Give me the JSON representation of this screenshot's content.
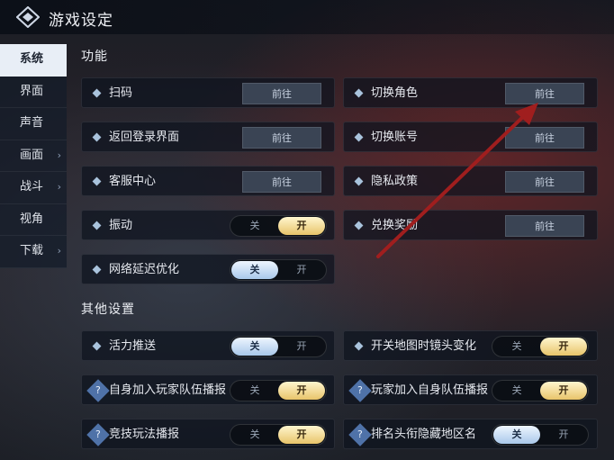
{
  "header": {
    "title": "游戏设定",
    "logo_icon": "diamond-emblem-icon"
  },
  "sidebar": {
    "items": [
      {
        "label": "系统",
        "active": true,
        "has_submenu": false
      },
      {
        "label": "界面",
        "active": false,
        "has_submenu": false
      },
      {
        "label": "声音",
        "active": false,
        "has_submenu": false
      },
      {
        "label": "画面",
        "active": false,
        "has_submenu": true
      },
      {
        "label": "战斗",
        "active": false,
        "has_submenu": true
      },
      {
        "label": "视角",
        "active": false,
        "has_submenu": false
      },
      {
        "label": "下载",
        "active": false,
        "has_submenu": true
      }
    ]
  },
  "sections": {
    "function_title": "功能",
    "other_title": "其他设置"
  },
  "function": {
    "scan": {
      "label": "扫码",
      "button": "前往"
    },
    "switch_role": {
      "label": "切换角色",
      "button": "前往"
    },
    "back_login": {
      "label": "返回登录界面",
      "button": "前往"
    },
    "switch_account": {
      "label": "切换账号",
      "button": "前往"
    },
    "customer_service": {
      "label": "客服中心",
      "button": "前往"
    },
    "privacy": {
      "label": "隐私政策",
      "button": "前往"
    },
    "vibration": {
      "label": "振动",
      "off": "关",
      "on": "开",
      "value": "开"
    },
    "redeem": {
      "label": "兑换奖励",
      "button": "前往"
    },
    "network": {
      "label": "网络延迟优化",
      "off": "关",
      "on": "开",
      "value": "关"
    }
  },
  "other": {
    "activity_push": {
      "label": "活力推送",
      "off": "关",
      "on": "开",
      "value": "关"
    },
    "map_camera": {
      "label": "开关地图时镜头变化",
      "off": "关",
      "on": "开",
      "value": "开"
    },
    "join_team_broadcast": {
      "label": "自身加入玩家队伍播报",
      "off": "关",
      "on": "开",
      "value": "开"
    },
    "player_join_broadcast": {
      "label": "玩家加入自身队伍播报",
      "off": "关",
      "on": "开",
      "value": "开"
    },
    "arena_broadcast": {
      "label": "竞技玩法播报",
      "off": "关",
      "on": "开",
      "value": "开"
    },
    "hide_region": {
      "label": "排名头衔隐藏地区名",
      "off": "关",
      "on": "开",
      "value": "关"
    }
  },
  "colors": {
    "toggle_on_yellow": "#e8c46a",
    "toggle_off_blue": "#a9c8ea",
    "annotation_arrow": "#a01e1e"
  }
}
